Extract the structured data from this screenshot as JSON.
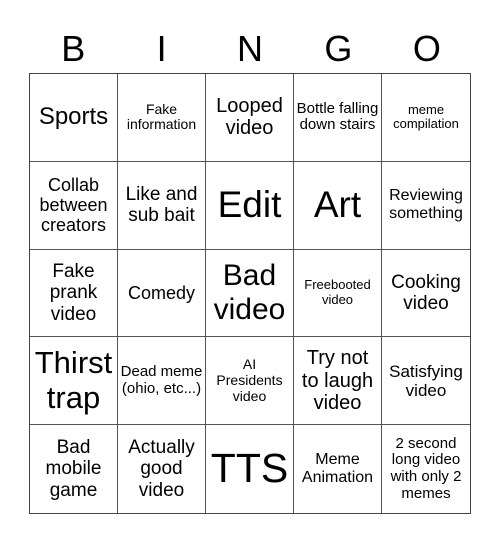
{
  "header": {
    "letters": [
      "B",
      "I",
      "N",
      "G",
      "O"
    ]
  },
  "cells": [
    [
      "Sports",
      "Fake information",
      "Looped video",
      "Bottle falling down stairs",
      "meme compilation"
    ],
    [
      "Collab between creators",
      "Like and sub bait",
      "Edit",
      "Art",
      "Reviewing something"
    ],
    [
      "Fake prank video",
      "Comedy",
      "Bad video",
      "Freebooted video",
      "Cooking video"
    ],
    [
      "Thirst trap",
      "Dead meme (ohio, etc...)",
      "AI Presidents video",
      "Try not to laugh video",
      "Satisfying video"
    ],
    [
      "Bad mobile game",
      "Actually good video",
      "TTS",
      "Meme Animation",
      "2 second long video with only 2 memes"
    ]
  ]
}
